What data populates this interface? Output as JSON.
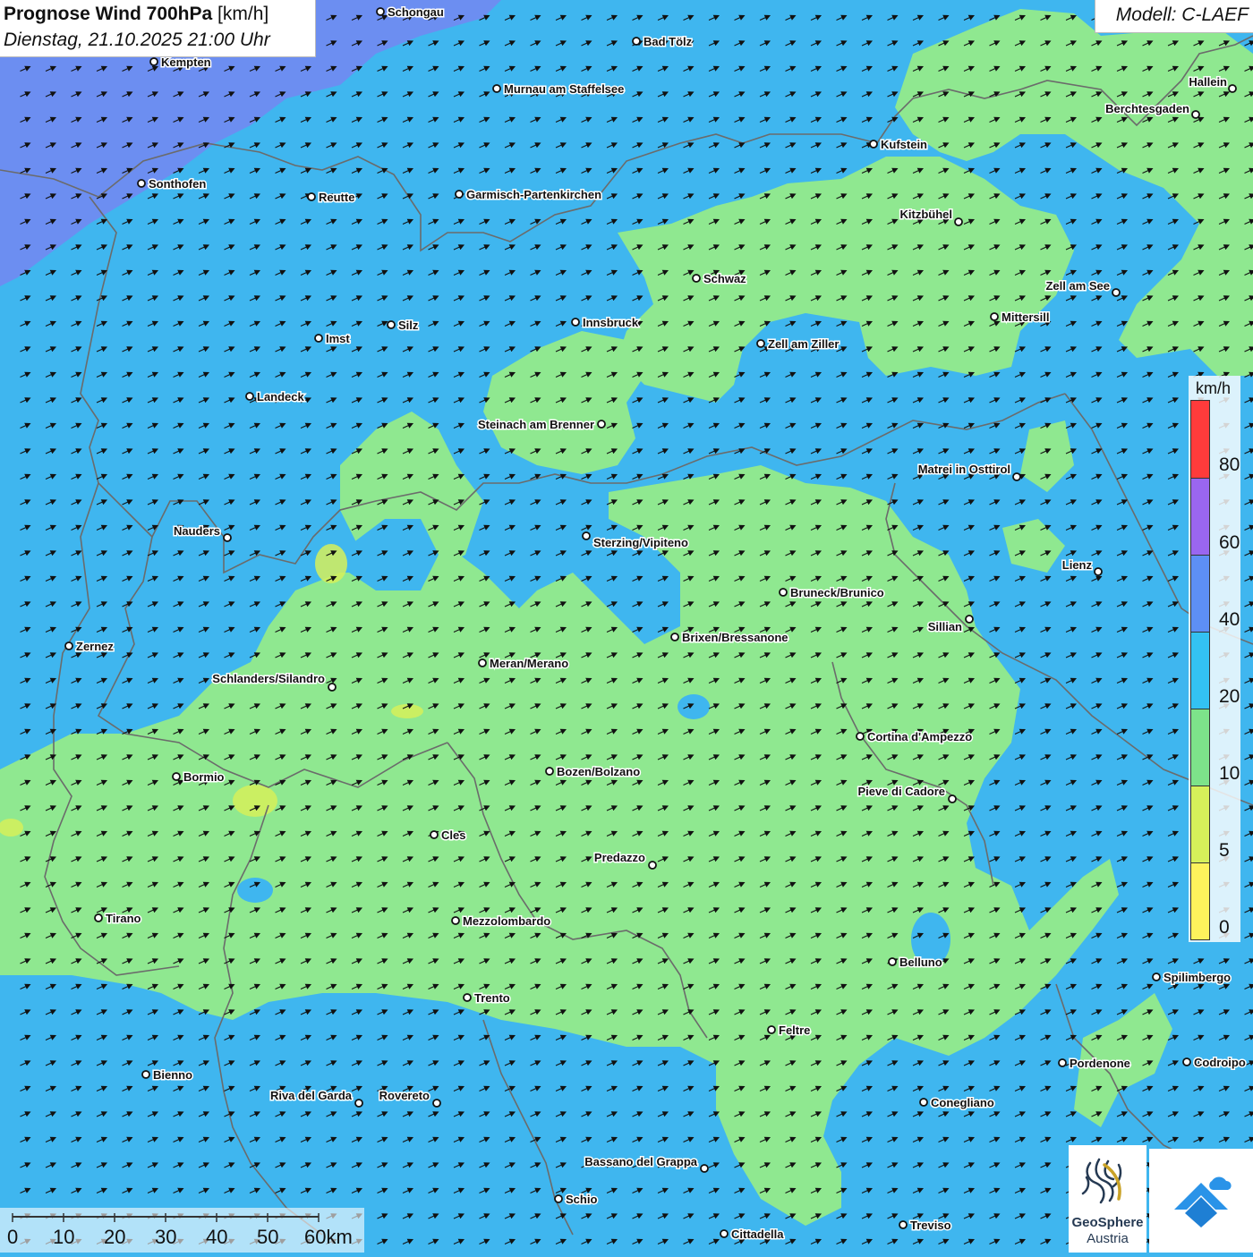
{
  "header": {
    "title_bold": "Prognose Wind 700hPa",
    "title_unit": "[km/h]",
    "datetime": "Dienstag, 21.10.2025 21:00 Uhr",
    "model": "Modell: C-LAEF"
  },
  "legend": {
    "unit": "km/h",
    "ticks": [
      "80",
      "60",
      "40",
      "20",
      "10",
      "5",
      "0"
    ],
    "colors": [
      "#ff3b3b",
      "#9a66f0",
      "#5d8ff5",
      "#33c2f2",
      "#7de38a",
      "#d6f05a",
      "#fdf25c"
    ]
  },
  "map_colors": {
    "low_wind": "#8fe890",
    "mid_wind": "#3fb6ef",
    "high_wind": "#6f8cf0",
    "border": "#6b6b6b",
    "arrow": "#111111"
  },
  "cities": [
    {
      "name": "Schongau"
    },
    {
      "name": "Bad Tölz"
    },
    {
      "name": "Kempten"
    },
    {
      "name": "Murnau am Staffelsee"
    },
    {
      "name": "Hallein"
    },
    {
      "name": "Berchtesgaden"
    },
    {
      "name": "Kufstein"
    },
    {
      "name": "Sonthofen"
    },
    {
      "name": "Reutte"
    },
    {
      "name": "Garmisch-Partenkirchen"
    },
    {
      "name": "Kitzbühel"
    },
    {
      "name": "Schwaz"
    },
    {
      "name": "Zell am See"
    },
    {
      "name": "Mittersill"
    },
    {
      "name": "Innsbruck"
    },
    {
      "name": "Silz"
    },
    {
      "name": "Imst"
    },
    {
      "name": "Zell am Ziller"
    },
    {
      "name": "Landeck"
    },
    {
      "name": "Steinach am Brenner"
    },
    {
      "name": "Matrei in Osttirol"
    },
    {
      "name": "Nauders"
    },
    {
      "name": "Sterzing/Vipiteno"
    },
    {
      "name": "Lienz"
    },
    {
      "name": "Bruneck/Brunico"
    },
    {
      "name": "Sillian"
    },
    {
      "name": "Brixen/Bressanone"
    },
    {
      "name": "Zernez"
    },
    {
      "name": "Meran/Merano"
    },
    {
      "name": "Schlanders/Silandro"
    },
    {
      "name": "Cortina d'Ampezzo"
    },
    {
      "name": "Bozen/Bolzano"
    },
    {
      "name": "Bormio"
    },
    {
      "name": "Pieve di Cadore"
    },
    {
      "name": "Cles"
    },
    {
      "name": "Predazzo"
    },
    {
      "name": "Tirano"
    },
    {
      "name": "Mezzolombardo"
    },
    {
      "name": "Belluno"
    },
    {
      "name": "Spilimbergo"
    },
    {
      "name": "Trento"
    },
    {
      "name": "Feltre"
    },
    {
      "name": "Pordenone"
    },
    {
      "name": "Codroipo"
    },
    {
      "name": "Bienno"
    },
    {
      "name": "Riva del Garda"
    },
    {
      "name": "Rovereto"
    },
    {
      "name": "Conegliano"
    },
    {
      "name": "Bassano del Grappa"
    },
    {
      "name": "Schio"
    },
    {
      "name": "Treviso"
    },
    {
      "name": "Cittadella"
    }
  ],
  "scale": {
    "labels": [
      "0",
      "10",
      "20",
      "30",
      "40",
      "50",
      "60km"
    ]
  },
  "logos": {
    "geosphere_name": "GeoSphere",
    "geosphere_sub": "Austria"
  }
}
